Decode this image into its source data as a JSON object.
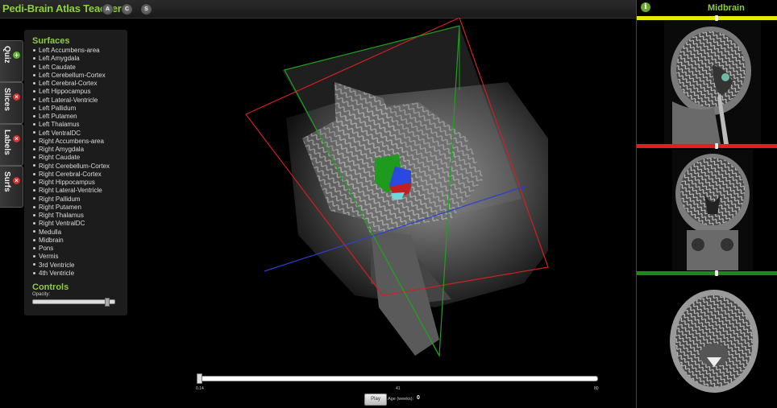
{
  "app": {
    "title": "Pedi-Brain Atlas Teacher"
  },
  "view_buttons": [
    {
      "label": "A"
    },
    {
      "label": "C"
    },
    {
      "label": "S"
    }
  ],
  "side_tabs": [
    {
      "label": "Quiz",
      "icon": "plus-icon",
      "icon_color": "#5cb82e"
    },
    {
      "label": "Slices",
      "icon": "close-icon",
      "icon_color": "#cc3333"
    },
    {
      "label": "Labels",
      "icon": "close-icon",
      "icon_color": "#cc3333"
    },
    {
      "label": "Surfs",
      "icon": "close-icon",
      "icon_color": "#cc3333"
    }
  ],
  "surfaces": {
    "heading": "Surfaces",
    "items": [
      "Left Accumbens-area",
      "Left Amygdala",
      "Left Caudate",
      "Left Cerebellum-Cortex",
      "Left Cerebral-Cortex",
      "Left Hippocampus",
      "Left Lateral-Ventricle",
      "Left Pallidum",
      "Left Putamen",
      "Left Thalamus",
      "Left VentralDC",
      "Right Accumbens-area",
      "Right Amygdala",
      "Right Caudate",
      "Right Cerebellum-Cortex",
      "Right Cerebral-Cortex",
      "Right Hippocampus",
      "Right Lateral-Ventricle",
      "Right Pallidum",
      "Right Putamen",
      "Right Thalamus",
      "Right VentralDC",
      "Medulla",
      "Midbrain",
      "Pons",
      "Vermis",
      "3rd Ventricle",
      "4th Ventricle"
    ]
  },
  "controls": {
    "heading": "Controls",
    "opacity_label": "Opacity:",
    "opacity_value": 0.9
  },
  "timeline": {
    "ticks": [
      {
        "label": "0.14"
      },
      {
        "label": "41"
      },
      {
        "label": "80"
      }
    ],
    "value": 0.14,
    "play_label": "Play",
    "age_label": "Age (weeks):",
    "age_value": "0"
  },
  "right_panel": {
    "info_icon": "i",
    "region_label": "Midbrain"
  },
  "colors": {
    "accent": "#8fce3d",
    "sagittal_plane": "#e8e800",
    "axial_plane_bar": "#e02020",
    "coronal_plane_bar": "#1a8a1a"
  }
}
